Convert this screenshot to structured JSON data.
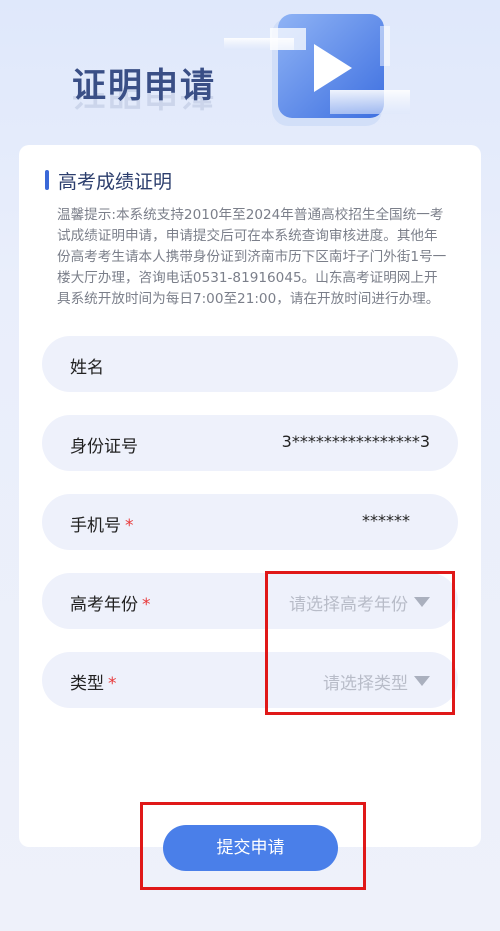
{
  "hero": {
    "title": "证明申请"
  },
  "section": {
    "title": "高考成绩证明"
  },
  "notice": "温馨提示:本系统支持2010年至2024年普通高校招生全国统一考试成绩证明申请，申请提交后可在本系统查询审核进度。其他年份高考考生请本人携带身份证到济南市历下区南圩子门外街1号一楼大厅办理，咨询电话0531-81916045。山东高考证明网上开具系统开放时间为每日7:00至21:00，请在开放时间进行办理。",
  "form": {
    "name": {
      "label": "姓名",
      "value": ""
    },
    "id_number": {
      "label": "身份证号",
      "value": "3****************3"
    },
    "phone": {
      "label": "手机号",
      "required_mark": "*",
      "value": "******"
    },
    "exam_year": {
      "label": "高考年份",
      "required_mark": "*",
      "placeholder": "请选择高考年份"
    },
    "type": {
      "label": "类型",
      "required_mark": "*",
      "placeholder": "请选择类型"
    }
  },
  "submit_label": "提交申请",
  "colors": {
    "accent": "#4a7fe9",
    "title_text": "#3a4f86",
    "required": "#e8393a",
    "annotation_red": "#e01818",
    "field_bg": "#eef1fb"
  }
}
